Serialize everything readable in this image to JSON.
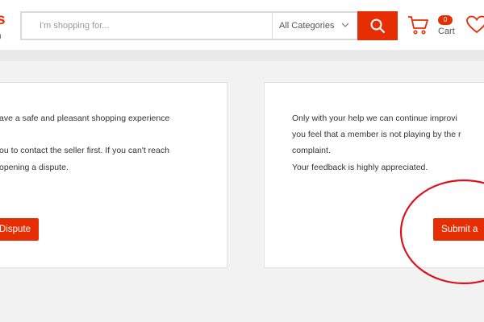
{
  "header": {
    "logo_text": "s",
    "logo_subtext": "g",
    "search": {
      "placeholder": "I'm shopping for..."
    },
    "category": {
      "selected": "All Categories"
    },
    "cart": {
      "count": "0",
      "label": "Cart"
    }
  },
  "left_panel": {
    "lines": [
      "ave a safe and pleasant shopping experience",
      "ou to contact the seller first. If you can't reach",
      "opening a dispute."
    ],
    "button_label": "Dispute"
  },
  "right_panel": {
    "lines": [
      "Only with your help we can continue improvi",
      "you feel that a member is not playing by the r",
      "complaint.",
      "Your feedback is highly appreciated."
    ],
    "button_label": "Submit a"
  },
  "colors": {
    "accent": "#e62e04",
    "annotation": "#d9141e"
  }
}
